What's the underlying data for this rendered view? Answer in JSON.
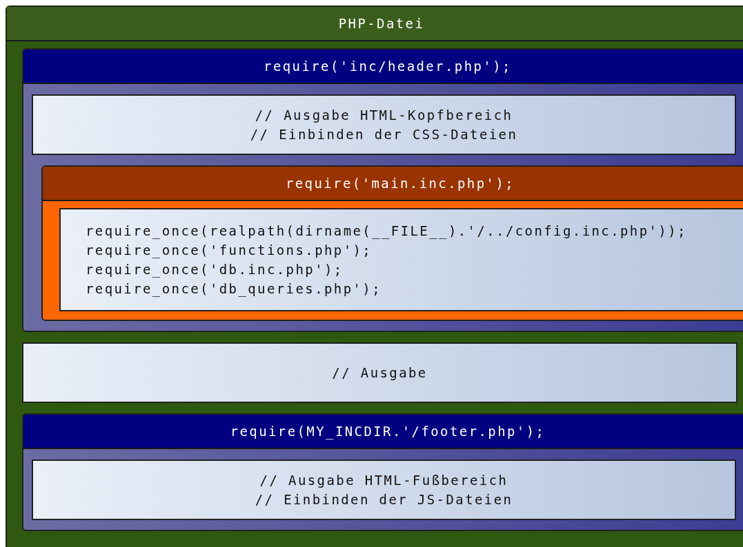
{
  "diagram": {
    "title": "PHP-Datei",
    "sections": [
      {
        "kind": "include",
        "title": "require('inc/header.php');",
        "children": [
          {
            "kind": "comment",
            "lines": [
              "// Ausgabe HTML-Kopfbereich",
              "// Einbinden der CSS-Dateien"
            ]
          },
          {
            "kind": "nested_include",
            "title": "require('main.inc.php');",
            "children": [
              {
                "kind": "code",
                "lines": [
                  "require_once(realpath(dirname(__FILE__).'/../config.inc.php'));",
                  "require_once('functions.php');",
                  "require_once('db.inc.php');",
                  "require_once('db_queries.php');"
                ]
              }
            ]
          }
        ]
      },
      {
        "kind": "comment",
        "lines": [
          "// Ausgabe"
        ]
      },
      {
        "kind": "include",
        "title": "require(MY_INCDIR.'/footer.php');",
        "children": [
          {
            "kind": "comment",
            "lines": [
              "// Ausgabe HTML-Fußbereich",
              "// Einbinden der JS-Dateien"
            ]
          }
        ]
      }
    ]
  }
}
